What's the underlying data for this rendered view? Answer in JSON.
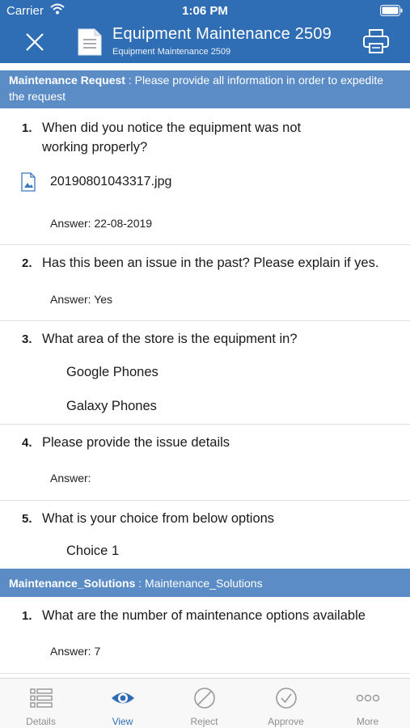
{
  "status_bar": {
    "carrier": "Carrier",
    "time": "1:06 PM"
  },
  "header": {
    "title": "Equipment Maintenance 2509",
    "subtitle": "Equipment Maintenance 2509"
  },
  "sections": [
    {
      "name": "Maintenance Request",
      "description": "Please provide all information in order to expedite the request",
      "questions": [
        {
          "number": "1.",
          "line1": "When did you notice the equipment was not",
          "line2": "working properly?",
          "attachment": "20190801043317.jpg",
          "answer": "Answer: 22-08-2019"
        },
        {
          "number": "2.",
          "text": "Has this been an issue in the past?  Please explain if yes.",
          "answer": "Answer: Yes"
        },
        {
          "number": "3.",
          "text": "What area of the store is the equipment in?",
          "options": [
            "Google Phones",
            "Galaxy Phones"
          ]
        },
        {
          "number": "4.",
          "text": "Please provide the issue details",
          "answer": "Answer:"
        },
        {
          "number": "5.",
          "text": "What is your choice from below options",
          "options": [
            "Choice 1"
          ]
        }
      ]
    },
    {
      "name": "Maintenance_Solutions",
      "description": "Maintenance_Solutions",
      "questions": [
        {
          "number": "1.",
          "text": "What are the number of maintenance options available",
          "answer": "Answer: 7"
        }
      ]
    }
  ],
  "tabs": [
    {
      "label": "Details",
      "icon": "list-icon",
      "active": false
    },
    {
      "label": "View",
      "icon": "eye-icon",
      "active": true
    },
    {
      "label": "Reject",
      "icon": "prohibited-icon",
      "active": false
    },
    {
      "label": "Approve",
      "icon": "checkmark-circle-icon",
      "active": false
    },
    {
      "label": "More",
      "icon": "ellipsis-icon",
      "active": false
    }
  ],
  "colors": {
    "header": "#2f6db4",
    "section_header": "#5b8cc5",
    "active_tab": "#2f6db4",
    "inactive_tab": "#8e8e8e"
  }
}
